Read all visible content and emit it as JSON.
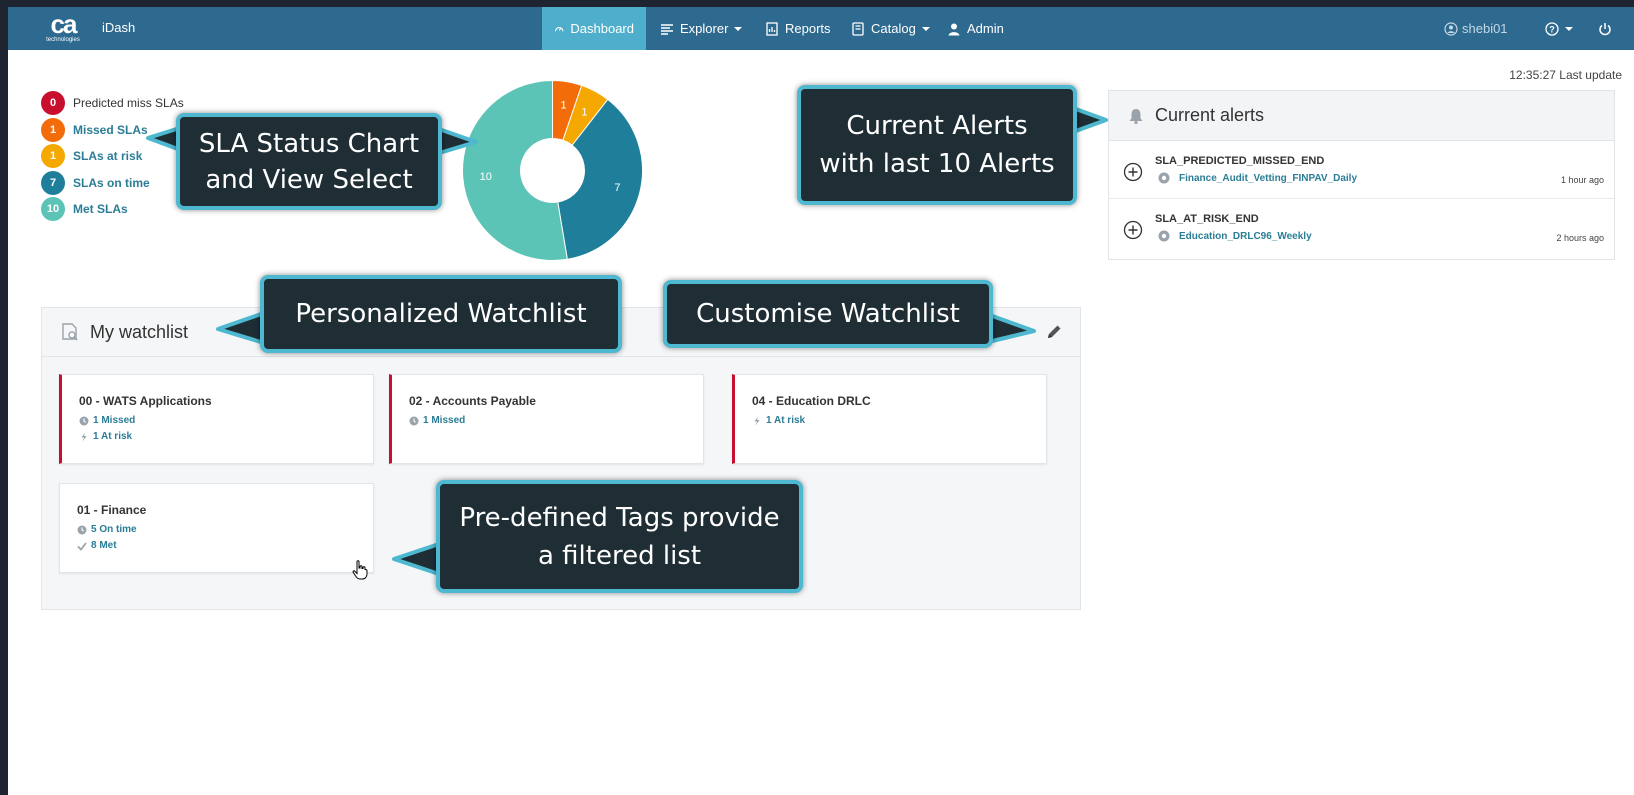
{
  "navbar": {
    "logo_text": "ca",
    "logo_sub": "technologies",
    "app_name": "iDash",
    "items": [
      {
        "label": "Dashboard",
        "icon": "gauge-icon",
        "active": true
      },
      {
        "label": "Explorer",
        "icon": "list-icon",
        "dropdown": true
      },
      {
        "label": "Reports",
        "icon": "report-icon"
      },
      {
        "label": "Catalog",
        "icon": "book-icon",
        "dropdown": true
      },
      {
        "label": "Admin",
        "icon": "user-icon"
      }
    ],
    "user": "shebi01",
    "help_icon": "help-icon",
    "power_icon": "power-icon"
  },
  "last_update": "12:35:27 Last update",
  "sla_status": [
    {
      "count": "0",
      "label": "Predicted miss SLAs",
      "color": "#c8102e"
    },
    {
      "count": "1",
      "label": "Missed SLAs",
      "color": "#f26d0a"
    },
    {
      "count": "1",
      "label": "SLAs at risk",
      "color": "#f5a800"
    },
    {
      "count": "7",
      "label": "SLAs on time",
      "color": "#1f7f9b"
    },
    {
      "count": "10",
      "label": "Met SLAs",
      "color": "#5cc4b6"
    }
  ],
  "chart_data": {
    "type": "pie",
    "donut": true,
    "categories": [
      "Missed SLAs",
      "SLAs at risk",
      "SLAs on time",
      "Met SLAs"
    ],
    "values": [
      1,
      1,
      7,
      10
    ],
    "colors": [
      "#f26d0a",
      "#f5a800",
      "#1f7f9b",
      "#5cc4b6"
    ]
  },
  "alerts": {
    "title": "Current alerts",
    "items": [
      {
        "title": "SLA_PREDICTED_MISSED_END",
        "link": "Finance_Audit_Vetting_FINPAV_Daily",
        "time": "1 hour ago"
      },
      {
        "title": "SLA_AT_RISK_END",
        "link": "Education_DRLC96_Weekly",
        "time": "2 hours ago"
      }
    ]
  },
  "watchlist": {
    "title": "My watchlist",
    "cards": [
      {
        "title": "00 - WATS Applications",
        "lines": [
          {
            "icon": "missed-icon",
            "text": "1 Missed"
          },
          {
            "icon": "at-risk-icon",
            "text": "1 At risk"
          }
        ],
        "alert": true
      },
      {
        "title": "02 - Accounts Payable",
        "lines": [
          {
            "icon": "missed-icon",
            "text": "1 Missed"
          }
        ],
        "alert": true
      },
      {
        "title": "04 - Education DRLC",
        "lines": [
          {
            "icon": "at-risk-icon",
            "text": "1 At risk"
          }
        ],
        "alert": true
      },
      {
        "title": "01 - Finance",
        "lines": [
          {
            "icon": "clock-icon",
            "text": "5 On time"
          },
          {
            "icon": "check-icon",
            "text": "8 Met"
          }
        ],
        "alert": false
      }
    ]
  },
  "callouts": {
    "sla": [
      "SLA Status Chart",
      "and View Select"
    ],
    "alerts": [
      "Current Alerts",
      "with last 10 Alerts"
    ],
    "personalized": "Personalized Watchlist",
    "customise": "Customise Watchlist",
    "tags": [
      "Pre-defined Tags provide",
      "a filtered list"
    ]
  }
}
